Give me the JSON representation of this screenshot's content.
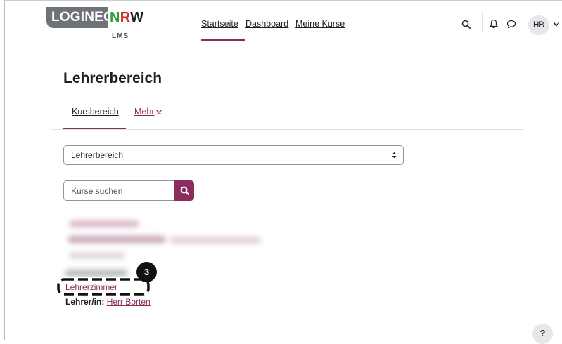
{
  "brand": {
    "logo_left": "LOGINEO",
    "logo_n": "N",
    "logo_r": "R",
    "logo_w": "W",
    "logo_sub": "LMS"
  },
  "nav": {
    "items": [
      {
        "label": "Startseite"
      },
      {
        "label": "Dashboard"
      },
      {
        "label": "Meine Kurse"
      }
    ],
    "user_initials": "HB"
  },
  "main": {
    "title": "Lehrerbereich",
    "tabs": [
      {
        "label": "Kursbereich"
      },
      {
        "label": "Mehr"
      }
    ],
    "category_select": {
      "selected": "Lehrerbereich"
    },
    "search": {
      "placeholder": "Kurse suchen"
    },
    "course": {
      "name": "Lehrerzimmer",
      "teacher_label": "Lehrer/in:",
      "teacher_name": "Herr Borten"
    },
    "step_badge": "3"
  },
  "help": {
    "label": "?"
  },
  "colors": {
    "accent": "#8b2c5f",
    "logo_grey": "#6f7378",
    "logo_green": "#2f9d3e",
    "logo_red": "#d52b1e"
  }
}
